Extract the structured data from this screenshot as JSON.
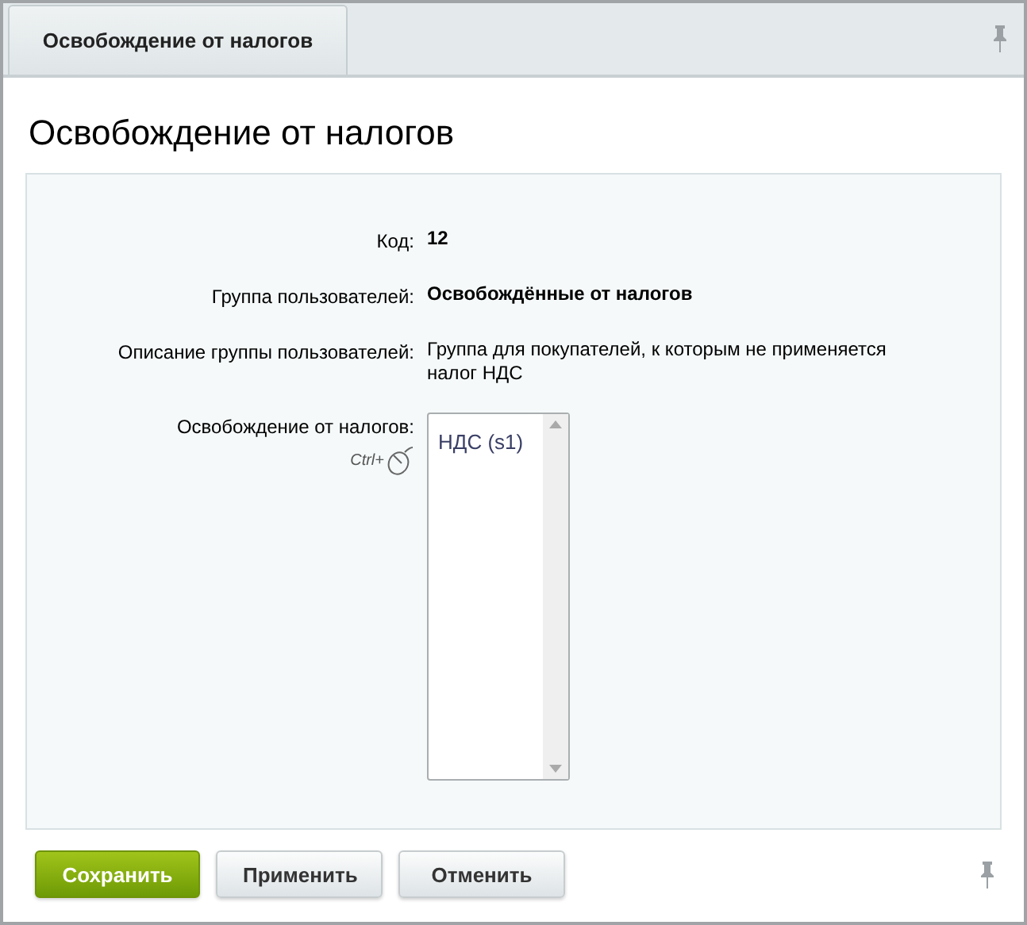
{
  "tabs": [
    {
      "label": "Освобождение от налогов",
      "selected": true
    }
  ],
  "title": "Освобождение от налогов",
  "fields": [
    {
      "kind": "text",
      "label": "Код:",
      "value": "12",
      "bold": true
    },
    {
      "kind": "text",
      "label": "Группа пользователей:",
      "value": "Освобождённые от налогов",
      "bold": true
    },
    {
      "kind": "text",
      "label": "Описание группы пользователей:",
      "value": "Группа для покупателей, к которым не применяется налог НДС",
      "bold": false
    },
    {
      "kind": "listbox",
      "label": "Освобождение от налогов:",
      "hint": "Ctrl+",
      "options": [
        {
          "label": "НДС (s1)",
          "selected": false
        }
      ]
    }
  ],
  "buttons": [
    {
      "label": "Сохранить",
      "kind": "primary"
    },
    {
      "label": "Применить",
      "kind": "secondary"
    },
    {
      "label": "Отменить",
      "kind": "secondary"
    }
  ]
}
